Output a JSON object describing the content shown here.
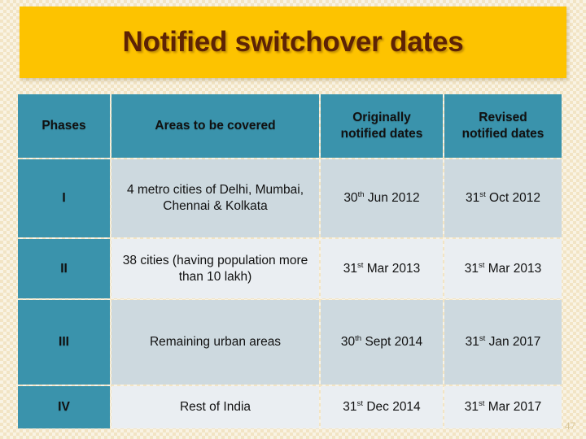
{
  "slide": {
    "title": "Notified switchover dates",
    "page_number": "47",
    "colors": {
      "banner": "#fdc300",
      "title_text": "#5d2305",
      "header_cell": "#3a93ac",
      "row_dark": "#cdd9df",
      "row_light": "#eaeef2",
      "background": "#f2e4c4"
    }
  },
  "table": {
    "headers": {
      "phases": "Phases",
      "areas": "Areas to be covered",
      "originally_line1": "Originally",
      "originally_line2": "notified dates",
      "revised_line1": "Revised",
      "revised_line2": "notified dates"
    },
    "rows": [
      {
        "phase": "I",
        "areas": "4 metro cities of Delhi, Mumbai, Chennai & Kolkata",
        "originally": {
          "day": "30",
          "ordinal": "th",
          "rest": " Jun 2012"
        },
        "revised": {
          "day": "31",
          "ordinal": "st",
          "rest": " Oct 2012"
        }
      },
      {
        "phase": "II",
        "areas": "38 cities (having population more than 10 lakh)",
        "originally": {
          "day": "31",
          "ordinal": "st",
          "rest": " Mar 2013"
        },
        "revised": {
          "day": "31",
          "ordinal": "st",
          "rest": " Mar 2013"
        }
      },
      {
        "phase": "III",
        "areas": "Remaining urban areas",
        "originally": {
          "day": "30",
          "ordinal": "th",
          "rest": " Sept 2014"
        },
        "revised": {
          "day": "31",
          "ordinal": "st",
          "rest": " Jan 2017"
        }
      },
      {
        "phase": "IV",
        "areas": "Rest of India",
        "originally": {
          "day": "31",
          "ordinal": "st",
          "rest": " Dec 2014"
        },
        "revised": {
          "day": "31",
          "ordinal": "st",
          "rest": " Mar 2017"
        }
      }
    ]
  }
}
